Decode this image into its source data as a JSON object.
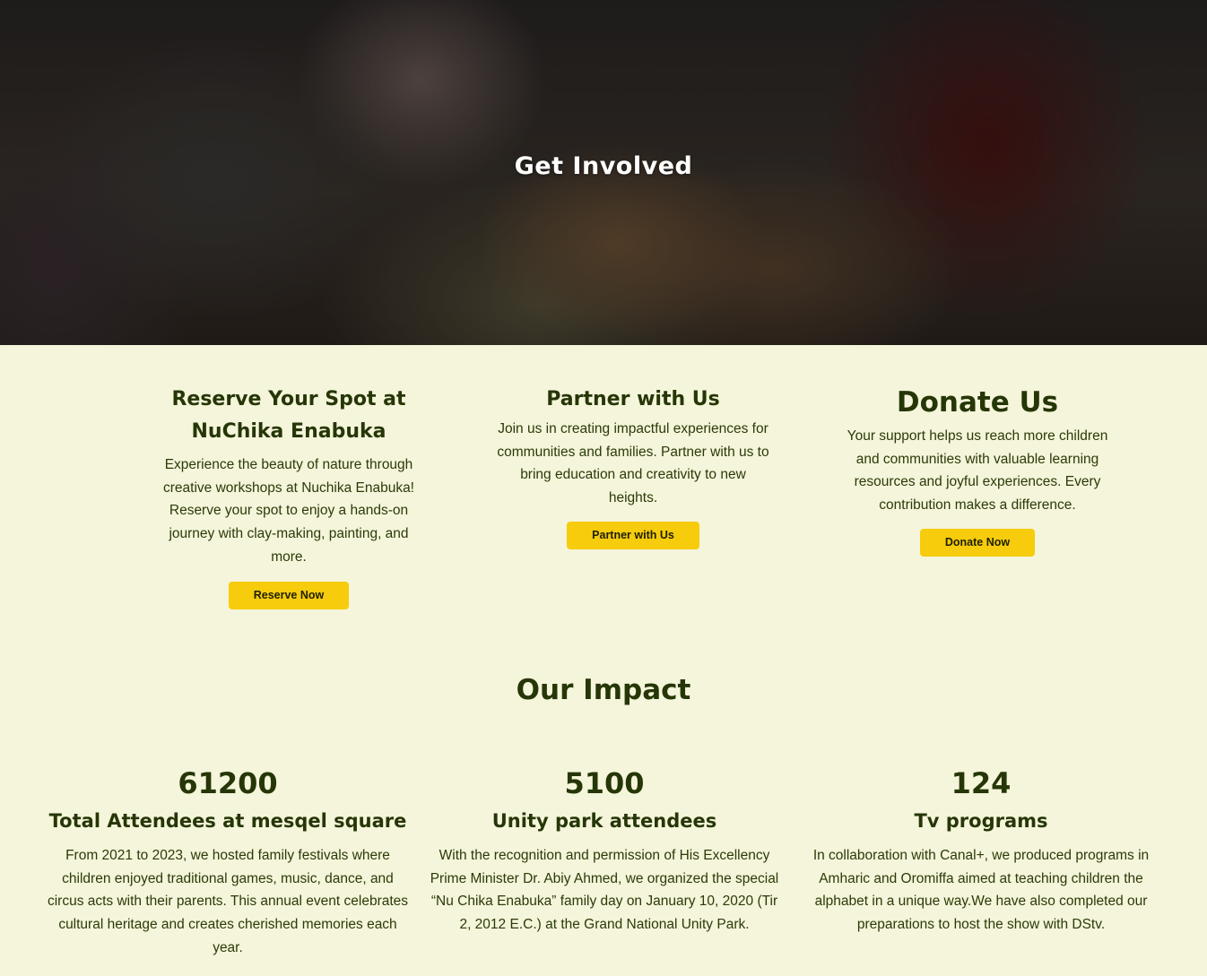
{
  "hero": {
    "title": "Get Involved"
  },
  "cards": [
    {
      "title_line1": "Reserve Your Spot at",
      "title_line2": "NuChika Enabuka",
      "body": "Experience the beauty of nature through creative workshops at Nuchika Enabuka! Reserve your spot to enjoy a hands-on journey with clay-making, painting, and more.",
      "button": "Reserve Now"
    },
    {
      "title": "Partner with Us",
      "body": "Join us in creating impactful experiences for communities and families. Partner with us to bring education and creativity to new heights.",
      "button": "Partner with Us"
    },
    {
      "title": "Donate Us",
      "body": "Your support helps us reach more children and communities with valuable learning resources and joyful experiences. Every contribution makes a difference.",
      "button": "Donate Now"
    }
  ],
  "impact": {
    "title": "Our Impact",
    "stats": [
      {
        "number": "61200",
        "label": "Total Attendees at mesqel square",
        "body": "From 2021 to 2023, we hosted family festivals where children enjoyed traditional games, music, dance, and circus acts with their parents. This annual event celebrates cultural heritage and creates cherished memories each year."
      },
      {
        "number": "5100",
        "label": "Unity park attendees",
        "body": "With the recognition and permission of His Excellency Prime Minister Dr. Abiy Ahmed, we organized the special “Nu Chika Enabuka” family day on January 10, 2020 (Tir 2, 2012 E.C.) at the Grand National Unity Park."
      },
      {
        "number": "124",
        "label": "Tv programs",
        "body": "In collaboration with Canal+, we produced programs in Amharic and Oromiffa aimed at teaching children the alphabet in a unique way.We have also completed our preparations to host the show with DStv."
      }
    ]
  },
  "colors": {
    "background": "#f4f5da",
    "heading": "#263607",
    "button": "#f6cc0c"
  }
}
